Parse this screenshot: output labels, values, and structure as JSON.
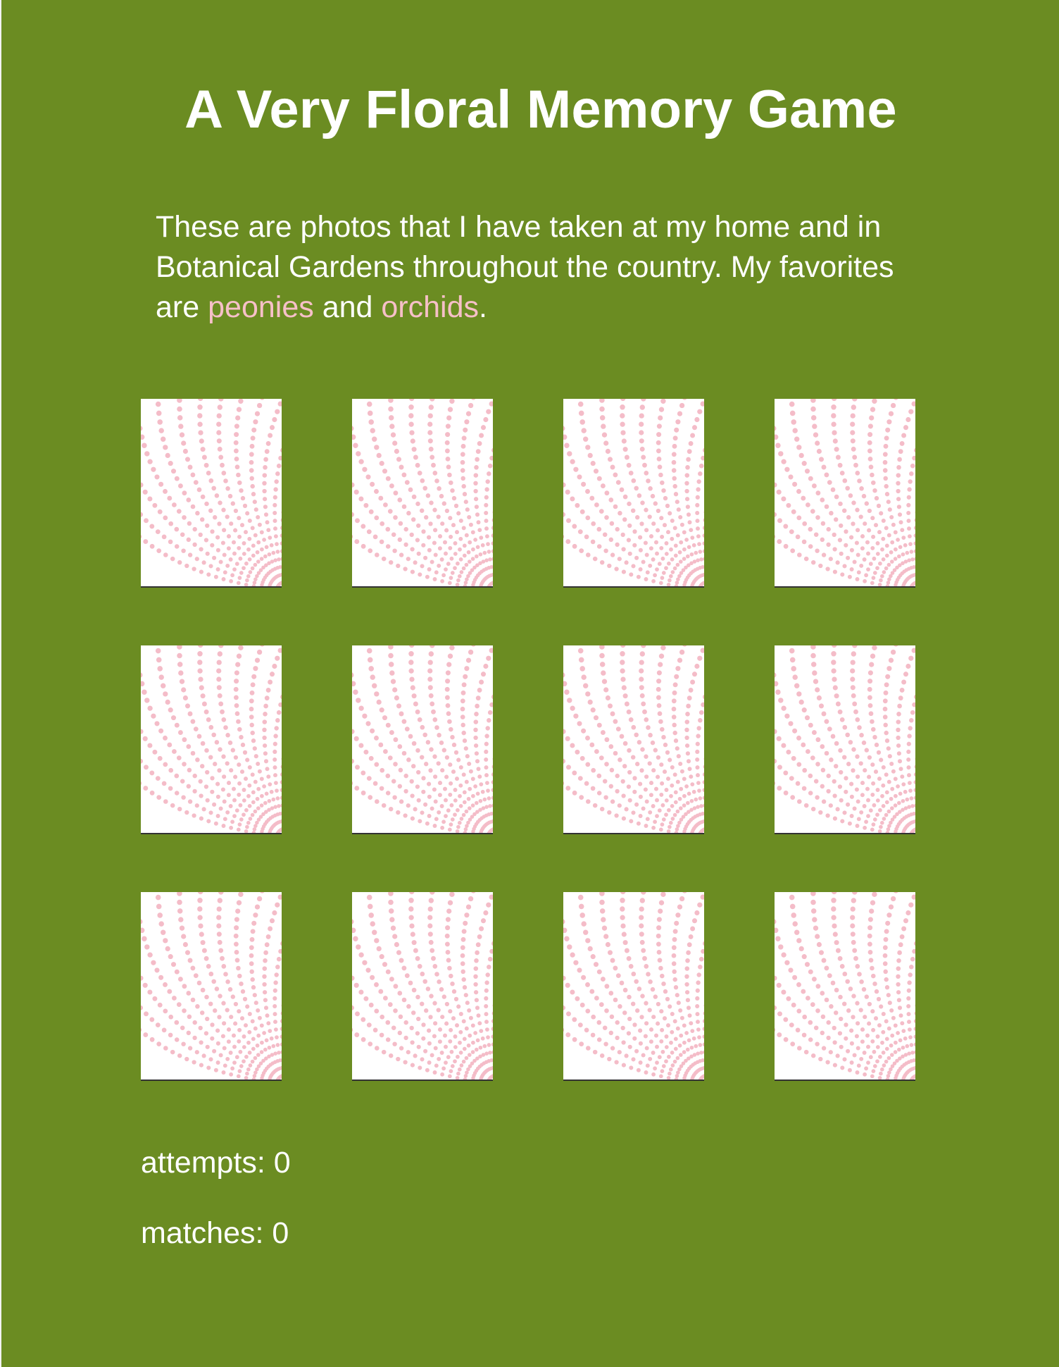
{
  "page": {
    "title": "A Very Floral Memory Game",
    "intro_before": "These are photos that I have taken at my home and in Botanical Gardens throughout the country. My favorites are ",
    "link_peonies": "peonies",
    "intro_middle": " and ",
    "link_orchids": "orchids",
    "intro_after": "."
  },
  "board": {
    "card_count": 12,
    "card_back_dot_color": "#f4bcc8",
    "card_back_background": "#ffffff"
  },
  "stats": {
    "attempts_label": "attempts: ",
    "attempts_value": "0",
    "matches_label": "matches: ",
    "matches_value": "0"
  },
  "colors": {
    "background": "#6b8c22",
    "text": "#ffffff",
    "link": "#f6c0c8"
  }
}
